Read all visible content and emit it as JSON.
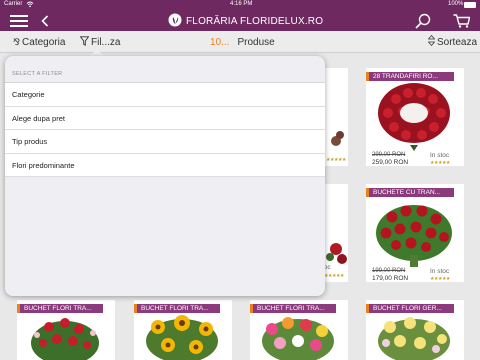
{
  "status_bar": {
    "carrier": "Carrier",
    "time": "4:16 PM",
    "battery": "100%"
  },
  "navbar": {
    "brand": "FLORĂRIA FLORIDELUX.RO",
    "menu_icon": "hamburger-icon",
    "back_icon": "chevron-left-icon",
    "search_icon": "search-icon",
    "cart_icon": "cart-icon"
  },
  "toolbar": {
    "category_label": "Categoria",
    "filter_label": "Fil...za",
    "product_count": "10...",
    "products_label": "Produse",
    "sort_label": "Sorteaza"
  },
  "filter_popup": {
    "header": "SELECT A FILTER",
    "items": [
      "Categorie",
      "Alege dupa pret",
      "Tip produs",
      "Flori predominante"
    ]
  },
  "products": [
    {
      "title": "28 TRANDAFIRI RO...",
      "old_price": "299,00 RON",
      "price": "259,00 RON",
      "stock": "In stoc",
      "stars": "★★★★★"
    },
    {
      "title": "BUCHETE CU TRAN...",
      "old_price": "199,00 RON",
      "price": "179,00 RON",
      "stock": "In stoc",
      "stars": "★★★★★"
    },
    {
      "title": "BUCHET FLORI TRA...",
      "stock": "",
      "stars": ""
    },
    {
      "title": "BUCHET FLORI TRA...",
      "stock": "",
      "stars": ""
    },
    {
      "title": "BUCHET FLORI TRA...",
      "stock": "",
      "stars": ""
    },
    {
      "title": "BUCHET FLORI GER...",
      "stock": "",
      "stars": ""
    }
  ],
  "partial_cards": {
    "stock": "toc",
    "stars": "★★★★★"
  },
  "colors": {
    "brand": "#6e2a60",
    "badge": "#8b3a7e",
    "accent": "#e8821e"
  }
}
